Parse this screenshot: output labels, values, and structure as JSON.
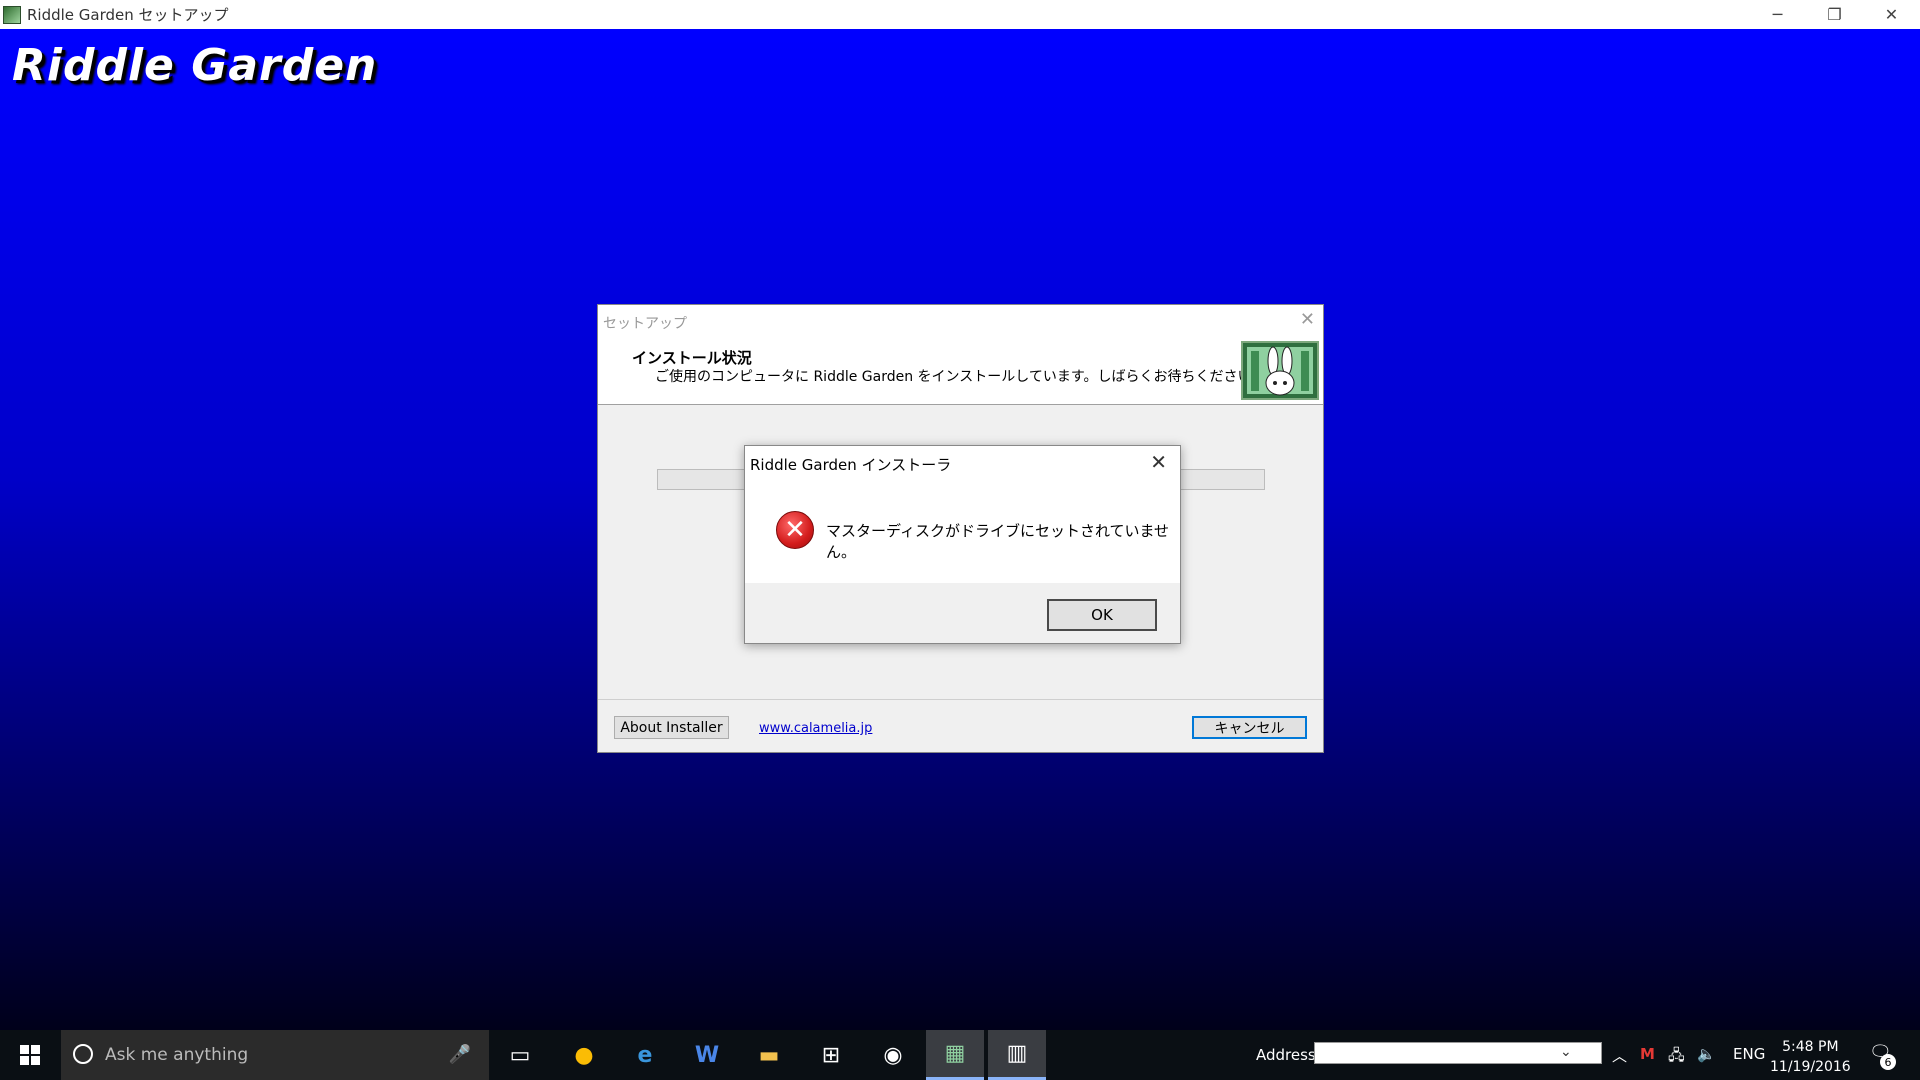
{
  "window": {
    "title": "Riddle Garden セットアップ",
    "minimize_glyph": "─",
    "restore_glyph": "❐",
    "close_glyph": "✕"
  },
  "background": {
    "logo_text": "Riddle Garden"
  },
  "setup_dialog": {
    "caption": "セットアップ",
    "close_glyph": "✕",
    "heading": "インストール状況",
    "description": "ご使用のコンピュータに Riddle Garden をインストールしています。しばらくお待ちください。",
    "progress": 0,
    "about_label": "About Installer",
    "link_text": "www.calamelia.jp",
    "cancel_label": "キャンセル"
  },
  "message_box": {
    "title": "Riddle Garden インストーラ",
    "close_glyph": "✕",
    "icon": "error-icon",
    "icon_glyph": "✕",
    "message": "マスターディスクがドライブにセットされていません。",
    "ok_label": "OK"
  },
  "taskbar": {
    "search_placeholder": "Ask me anything",
    "apps": [
      {
        "icon": "task-view-icon",
        "glyph": "▭"
      },
      {
        "icon": "chrome-icon",
        "glyph": "●"
      },
      {
        "icon": "edge-icon",
        "glyph": "e"
      },
      {
        "icon": "word-icon",
        "glyph": "W"
      },
      {
        "icon": "file-explorer-icon",
        "glyph": "▬"
      },
      {
        "icon": "store-icon",
        "glyph": "⊞"
      },
      {
        "icon": "groove-music-icon",
        "glyph": "◉"
      },
      {
        "icon": "riddle-garden-icon",
        "glyph": "▦"
      },
      {
        "icon": "barcode-app-icon",
        "glyph": "▥"
      }
    ],
    "address_label": "Address",
    "address_value": "",
    "clock_time": "5:48 PM",
    "clock_date": "11/19/2016",
    "language": "ENG",
    "notification_count": "6"
  },
  "colors": {
    "background_top": "#0000ff",
    "background_bottom": "#00001a",
    "cancel_focus_border": "#0078d7",
    "link": "#0000cc",
    "error_red": "#d31c1c"
  }
}
